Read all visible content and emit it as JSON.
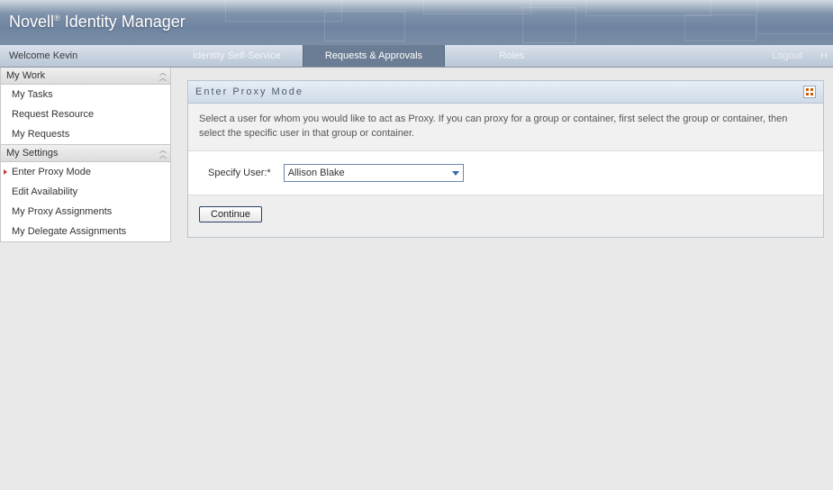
{
  "header": {
    "brand_prefix": "Novell",
    "brand_suffix": "Identity Manager"
  },
  "navbar": {
    "welcome": "Welcome Kevin",
    "tabs": [
      {
        "label": "Identity Self-Service",
        "active": false
      },
      {
        "label": "Requests & Approvals",
        "active": true
      },
      {
        "label": "Roles",
        "active": false
      }
    ],
    "right": {
      "logout": "Logout",
      "help": "H"
    }
  },
  "sidebar": {
    "sections": [
      {
        "title": "My Work",
        "items": [
          {
            "label": "My Tasks"
          },
          {
            "label": "Request Resource"
          },
          {
            "label": "My Requests"
          }
        ]
      },
      {
        "title": "My Settings",
        "items": [
          {
            "label": "Enter Proxy Mode",
            "active": true
          },
          {
            "label": "Edit Availability"
          },
          {
            "label": "My Proxy Assignments"
          },
          {
            "label": "My Delegate Assignments"
          }
        ]
      }
    ]
  },
  "panel": {
    "title": "Enter Proxy Mode",
    "description": "Select a user for whom you would like to act as Proxy. If you can proxy for a group or container, first select the group or container, then select the specific user in that group or container.",
    "form": {
      "label": "Specify User:*",
      "value": "Allison Blake"
    },
    "actions": {
      "continue": "Continue"
    }
  }
}
